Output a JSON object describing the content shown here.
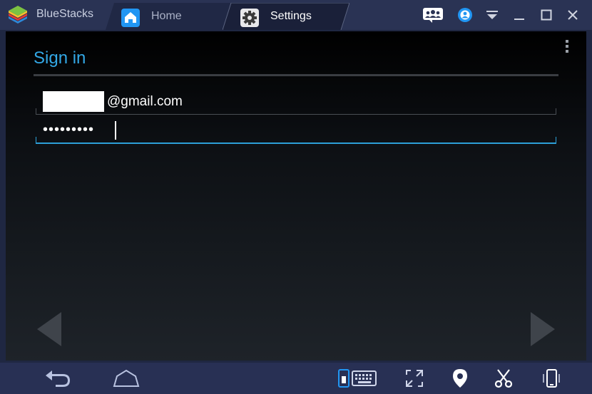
{
  "app": {
    "name": "BlueStacks"
  },
  "tabs": [
    {
      "label": "Home",
      "icon": "home-icon",
      "color": "#2196f3"
    },
    {
      "label": "Settings",
      "icon": "gear-icon",
      "active": true
    }
  ],
  "window_controls": [
    "multi-instance-icon",
    "account-icon",
    "menu-dropdown-icon",
    "minimize-icon",
    "maximize-icon",
    "close-icon"
  ],
  "signin": {
    "title": "Sign in",
    "email_suffix": "@gmail.com",
    "password_mask": "•••••••••"
  },
  "colors": {
    "accent": "#33a8e6",
    "titlebar": "#2a3354",
    "bottombar": "#283054"
  },
  "bottom_bar": [
    "back-icon",
    "home-nav-icon",
    "keymap-icon",
    "fullscreen-icon",
    "location-icon",
    "screenshot-scissors-icon",
    "rotate-device-icon"
  ]
}
